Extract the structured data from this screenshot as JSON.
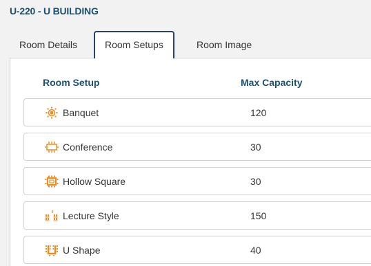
{
  "header": {
    "title": "U-220 - U BUILDING"
  },
  "tabs": [
    {
      "label": "Room Details"
    },
    {
      "label": "Room Setups"
    },
    {
      "label": "Room Image"
    }
  ],
  "table": {
    "columns": [
      "Room Setup",
      "Max Capacity"
    ],
    "rows": [
      {
        "name": "Banquet",
        "capacity": "120",
        "icon": "banquet-icon"
      },
      {
        "name": "Conference",
        "capacity": "30",
        "icon": "conference-icon"
      },
      {
        "name": "Hollow Square",
        "capacity": "30",
        "icon": "hollow-square-icon"
      },
      {
        "name": "Lecture Style",
        "capacity": "150",
        "icon": "lecture-style-icon"
      },
      {
        "name": "U Shape",
        "capacity": "40",
        "icon": "u-shape-icon"
      }
    ]
  },
  "colors": {
    "accent": "#1d4f6e",
    "tab_border": "#2a3f6c",
    "icon": "#f08a1c"
  }
}
